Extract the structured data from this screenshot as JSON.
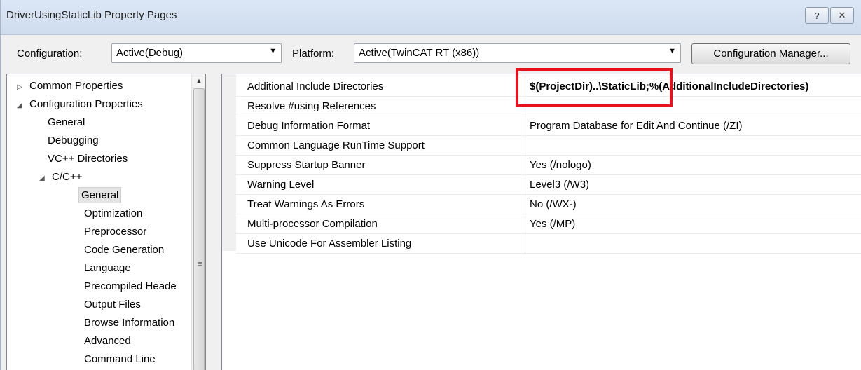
{
  "window": {
    "title": "DriverUsingStaticLib Property Pages",
    "help_glyph": "?",
    "close_glyph": "✕"
  },
  "config": {
    "configuration_label": "Configuration:",
    "configuration_value": "Active(Debug)",
    "platform_label": "Platform:",
    "platform_value": "Active(TwinCAT RT (x86))",
    "manager_button": "Configuration Manager...",
    "arrow": "▼"
  },
  "tree": {
    "scroll_up": "▲",
    "scroll_grip": "≡",
    "items": [
      {
        "label": "Common Properties",
        "toggle": "▷"
      },
      {
        "label": "Configuration Properties",
        "toggle": "◢"
      },
      {
        "label": "General"
      },
      {
        "label": "Debugging"
      },
      {
        "label": "VC++ Directories"
      },
      {
        "label": "C/C++",
        "toggle": "◢"
      },
      {
        "label": "General",
        "selected": true
      },
      {
        "label": "Optimization"
      },
      {
        "label": "Preprocessor"
      },
      {
        "label": "Code Generation"
      },
      {
        "label": "Language"
      },
      {
        "label": "Precompiled Heade"
      },
      {
        "label": "Output Files"
      },
      {
        "label": "Browse Information"
      },
      {
        "label": "Advanced"
      },
      {
        "label": "Command Line"
      }
    ]
  },
  "properties": [
    {
      "name": "Additional Include Directories",
      "value": "$(ProjectDir)..\\StaticLib;%(AdditionalIncludeDirectories)",
      "bold": true
    },
    {
      "name": "Resolve #using References",
      "value": ""
    },
    {
      "name": "Debug Information Format",
      "value": "Program Database for Edit And Continue (/ZI)"
    },
    {
      "name": "Common Language RunTime Support",
      "value": ""
    },
    {
      "name": "Suppress Startup Banner",
      "value": "Yes (/nologo)"
    },
    {
      "name": "Warning Level",
      "value": "Level3 (/W3)"
    },
    {
      "name": "Treat Warnings As Errors",
      "value": "No (/WX-)"
    },
    {
      "name": "Multi-processor Compilation",
      "value": "Yes (/MP)"
    },
    {
      "name": "Use Unicode For Assembler Listing",
      "value": ""
    }
  ],
  "colors": {
    "highlight": "#e8121f",
    "selection_bg": "#e5e5e5"
  }
}
